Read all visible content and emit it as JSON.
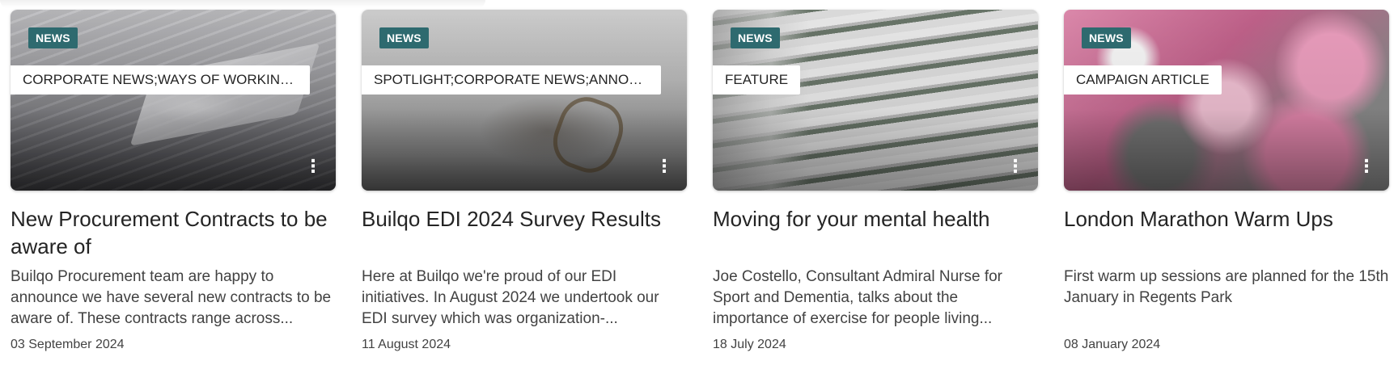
{
  "cards": [
    {
      "type": "NEWS",
      "topics": "CORPORATE NEWS;WAYS OF WORKING...",
      "title": "New Procurement Contracts to be aware of",
      "description": "Builqo Procurement team are happy to announce we have several new contracts to be aware of. These contracts range across...",
      "date": "03 September 2024",
      "image": "laptop-keyboard",
      "more_icon": "more-vertical-icon"
    },
    {
      "type": "NEWS",
      "topics": "SPOTLIGHT;CORPORATE NEWS;ANNOU...",
      "title": "Builqo EDI 2024 Survey Results",
      "description": "Here at Builqo we're proud of our EDI initiatives. In August 2024 we undertook our EDI survey which was organization-...",
      "date": "11 August 2024",
      "image": "glasses-shadow",
      "more_icon": "more-vertical-icon"
    },
    {
      "type": "NEWS",
      "topics": "FEATURE",
      "title": "Moving for your mental health",
      "description": "Joe Costello, Consultant Admiral Nurse for Sport and Dementia, talks about the importance of exercise for people living...",
      "date": "18 July 2024",
      "image": "curved-building",
      "more_icon": "more-vertical-icon"
    },
    {
      "type": "NEWS",
      "topics": "CAMPAIGN ARTICLE",
      "title": "London Marathon Warm Ups",
      "description": "First warm up sessions are planned for the 15th January in Regents Park",
      "date": "08 January 2024",
      "image": "runners-huddle",
      "more_icon": "more-vertical-icon"
    }
  ],
  "colors": {
    "badge_bg": "#2e6a6f",
    "text_primary": "#242424",
    "text_secondary": "#424242"
  }
}
